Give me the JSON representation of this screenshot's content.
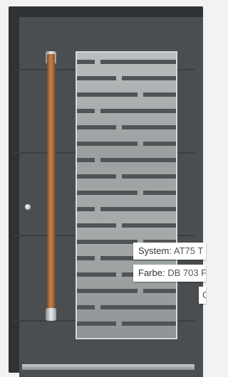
{
  "labels": [
    {
      "key": "System:",
      "value": "AT75 T"
    },
    {
      "key": "Farbe:",
      "value": "DB 703 F"
    },
    {
      "key": "",
      "value": "C"
    }
  ]
}
